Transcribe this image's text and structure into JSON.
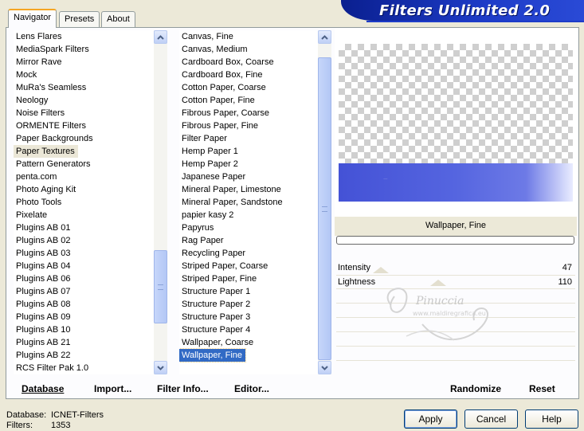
{
  "tabs": [
    "Navigator",
    "Presets",
    "About"
  ],
  "banner_title": "Filters Unlimited 2.0",
  "categories": {
    "items": [
      "Lens Flares",
      "MediaSpark Filters",
      "Mirror Rave",
      "Mock",
      "MuRa's Seamless",
      "Neology",
      "Noise Filters",
      "ORMENTE Filters",
      "Paper Backgrounds",
      "Paper Textures",
      "Pattern Generators",
      "penta.com",
      "Photo Aging Kit",
      "Photo Tools",
      "Pixelate",
      "Plugins AB 01",
      "Plugins AB 02",
      "Plugins AB 03",
      "Plugins AB 04",
      "Plugins AB 06",
      "Plugins AB 07",
      "Plugins AB 08",
      "Plugins AB 09",
      "Plugins AB 10",
      "Plugins AB 21",
      "Plugins AB 22",
      "RCS Filter Pak 1.0"
    ],
    "selected": "Paper Textures"
  },
  "filters": {
    "items": [
      "Canvas, Fine",
      "Canvas, Medium",
      "Cardboard Box, Coarse",
      "Cardboard Box, Fine",
      "Cotton Paper, Coarse",
      "Cotton Paper, Fine",
      "Fibrous Paper, Coarse",
      "Fibrous Paper, Fine",
      "Filter Paper",
      "Hemp Paper 1",
      "Hemp Paper 2",
      "Japanese Paper",
      "Mineral Paper, Limestone",
      "Mineral Paper, Sandstone",
      "papier kasy 2",
      "Papyrus",
      "Rag Paper",
      "Recycling Paper",
      "Striped Paper, Coarse",
      "Striped Paper, Fine",
      "Structure Paper 1",
      "Structure Paper 2",
      "Structure Paper 3",
      "Structure Paper 4",
      "Wallpaper, Coarse",
      "Wallpaper, Fine"
    ],
    "selected": "Wallpaper, Fine"
  },
  "preview": {
    "filter_name": "Wallpaper, Fine",
    "progress": 0
  },
  "sliders": [
    {
      "label": "Intensity",
      "value": "47"
    },
    {
      "label": "Lightness",
      "value": "110"
    }
  ],
  "toolbar": {
    "database": "Database",
    "import": "Import...",
    "filter_info": "Filter Info...",
    "editor": "Editor...",
    "randomize": "Randomize",
    "reset": "Reset"
  },
  "status": {
    "database_label": "Database:",
    "database_value": "ICNET-Filters",
    "filters_label": "Filters:",
    "filters_value": "1353"
  },
  "buttons": {
    "apply": "Apply",
    "cancel": "Cancel",
    "help": "Help"
  },
  "watermark": "Pinuccia www.maldiregrafica.eu",
  "colors": {
    "banner": "#1e3cc8",
    "selection": "#316ac5",
    "preview_texture": "#5060dc"
  }
}
